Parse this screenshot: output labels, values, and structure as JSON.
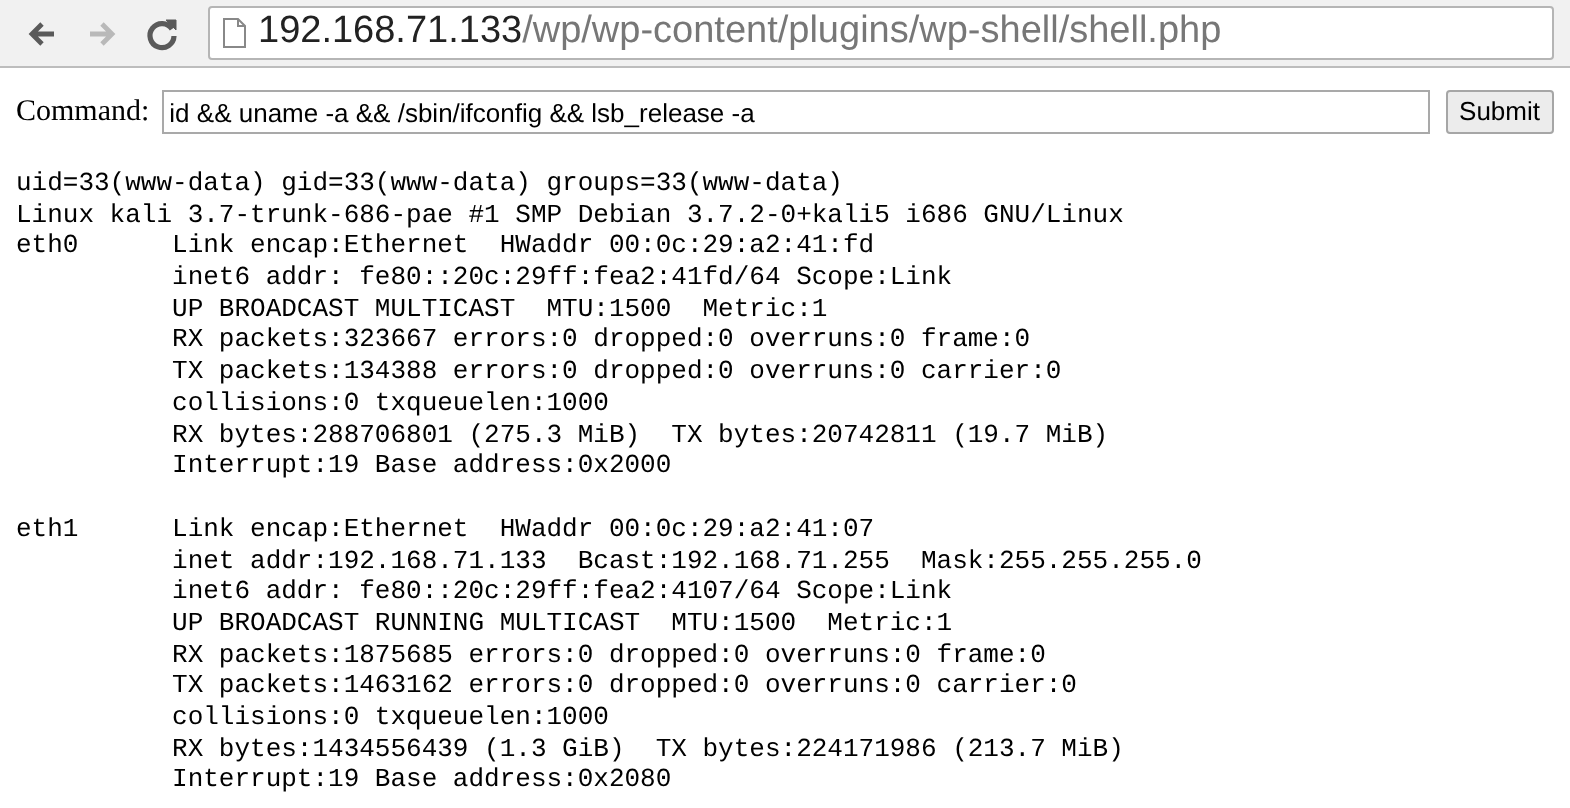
{
  "toolbar": {
    "nav": [
      {
        "kind": "back",
        "disabled": false
      },
      {
        "kind": "forward",
        "disabled": true
      },
      {
        "kind": "reload",
        "disabled": false
      }
    ],
    "address": {
      "host": "192.168.71.133",
      "path": "/wp/wp-content/plugins/wp-shell/shell.php"
    }
  },
  "form": {
    "label": "Command:",
    "value": "id && uname -a && /sbin/ifconfig && lsb_release -a",
    "button": "Submit"
  },
  "output_blocks": [
    [
      "uid=33(www-data) gid=33(www-data) groups=33(www-data)",
      "Linux kali 3.7-trunk-686-pae #1 SMP Debian 3.7.2-0+kali5 i686 GNU/Linux",
      "eth0      Link encap:Ethernet  HWaddr 00:0c:29:a2:41:fd",
      "          inet6 addr: fe80::20c:29ff:fea2:41fd/64 Scope:Link",
      "          UP BROADCAST MULTICAST  MTU:1500  Metric:1",
      "          RX packets:323667 errors:0 dropped:0 overruns:0 frame:0",
      "          TX packets:134388 errors:0 dropped:0 overruns:0 carrier:0",
      "          collisions:0 txqueuelen:1000",
      "          RX bytes:288706801 (275.3 MiB)  TX bytes:20742811 (19.7 MiB)",
      "          Interrupt:19 Base address:0x2000"
    ],
    [
      "eth1      Link encap:Ethernet  HWaddr 00:0c:29:a2:41:07",
      "          inet addr:192.168.71.133  Bcast:192.168.71.255  Mask:255.255.255.0",
      "          inet6 addr: fe80::20c:29ff:fea2:4107/64 Scope:Link",
      "          UP BROADCAST RUNNING MULTICAST  MTU:1500  Metric:1",
      "          RX packets:1875685 errors:0 dropped:0 overruns:0 frame:0",
      "          TX packets:1463162 errors:0 dropped:0 overruns:0 carrier:0",
      "          collisions:0 txqueuelen:1000",
      "          RX bytes:1434556439 (1.3 GiB)  TX bytes:224171986 (213.7 MiB)",
      "          Interrupt:19 Base address:0x2080"
    ]
  ]
}
